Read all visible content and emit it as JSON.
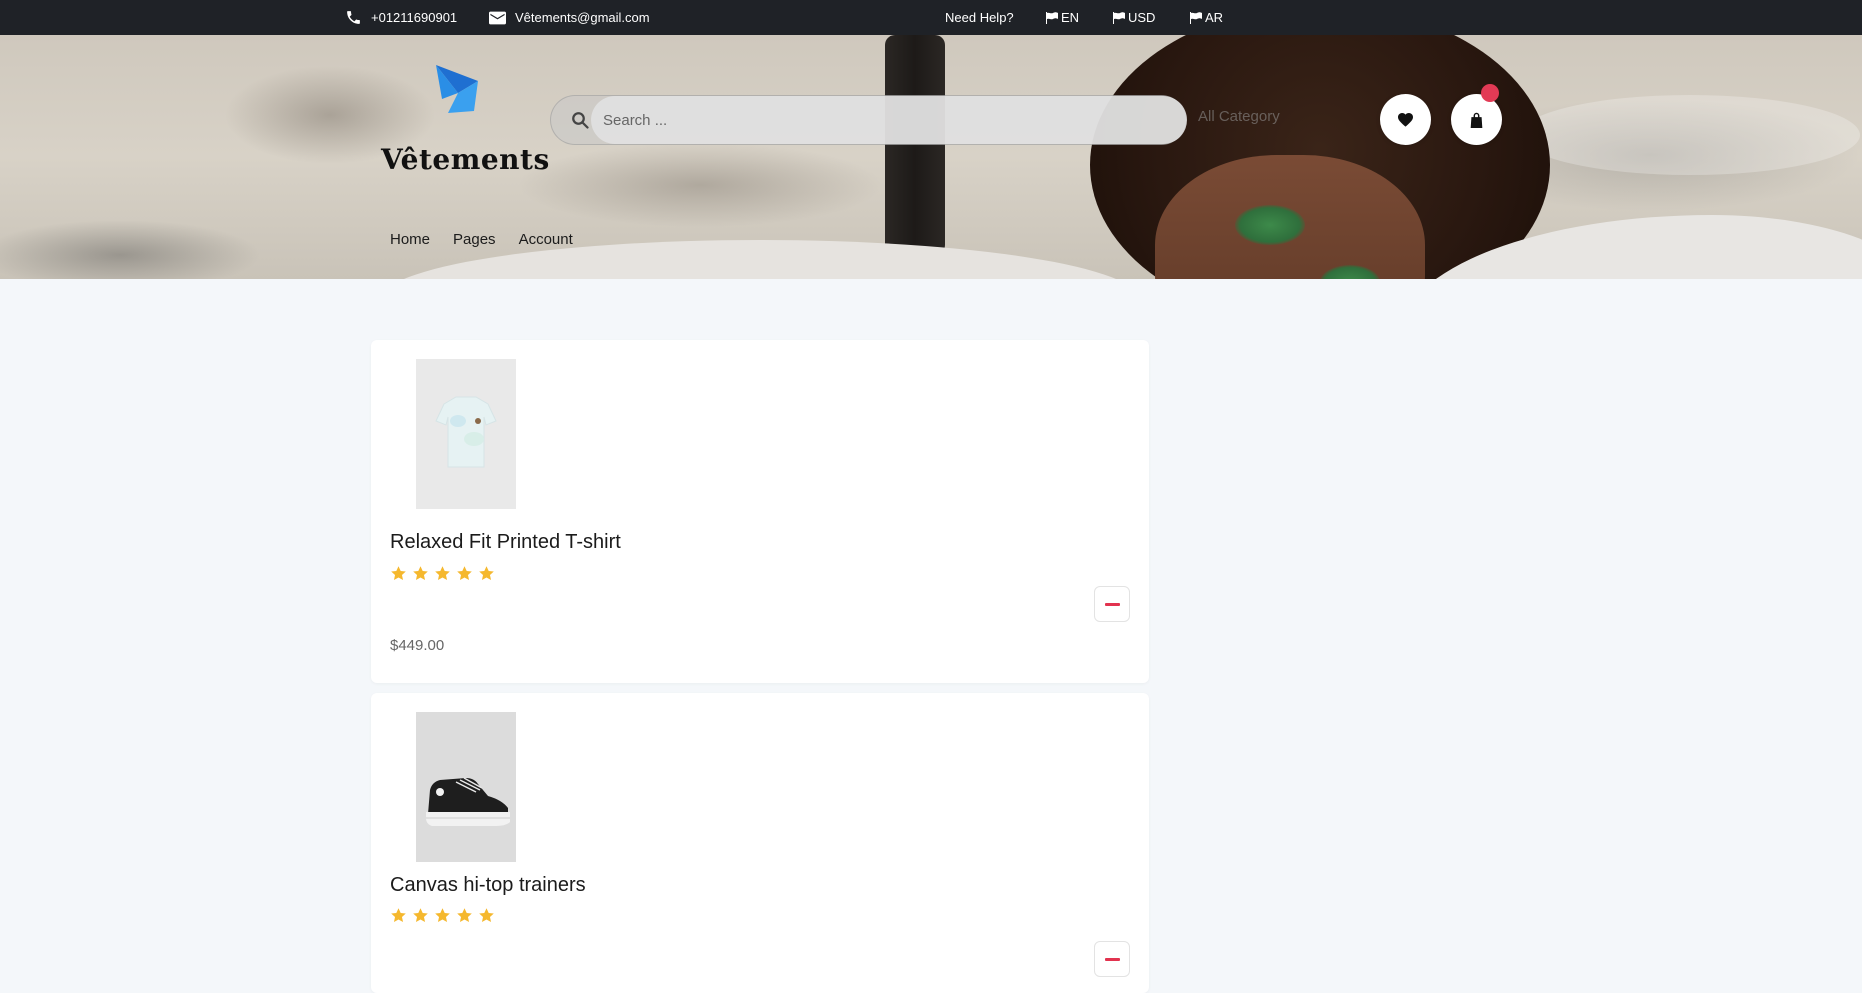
{
  "topbar": {
    "phone": "+01211690901",
    "email": "Vêtements@gmail.com",
    "help": "Need Help?",
    "lang_en": "EN",
    "currency": "USD",
    "lang_ar": "AR"
  },
  "header": {
    "brand": "Vêtements",
    "search_placeholder": "Search ...",
    "category": "All Category"
  },
  "nav": {
    "items": [
      "Home",
      "Pages",
      "Account"
    ]
  },
  "products": [
    {
      "title": "Relaxed Fit Printed T-shirt",
      "rating": 5,
      "price": "$449.00"
    },
    {
      "title": "Canvas hi-top trainers",
      "rating": 5,
      "price": ""
    }
  ],
  "colors": {
    "topbar": "#1f2227",
    "accent": "#e2334f",
    "star": "#f5b82e",
    "background": "#f4f7fa"
  },
  "icons": [
    "phone-icon",
    "mail-icon",
    "flag-icon",
    "search-icon",
    "heart-icon",
    "bag-icon",
    "star-icon",
    "minus-icon"
  ]
}
